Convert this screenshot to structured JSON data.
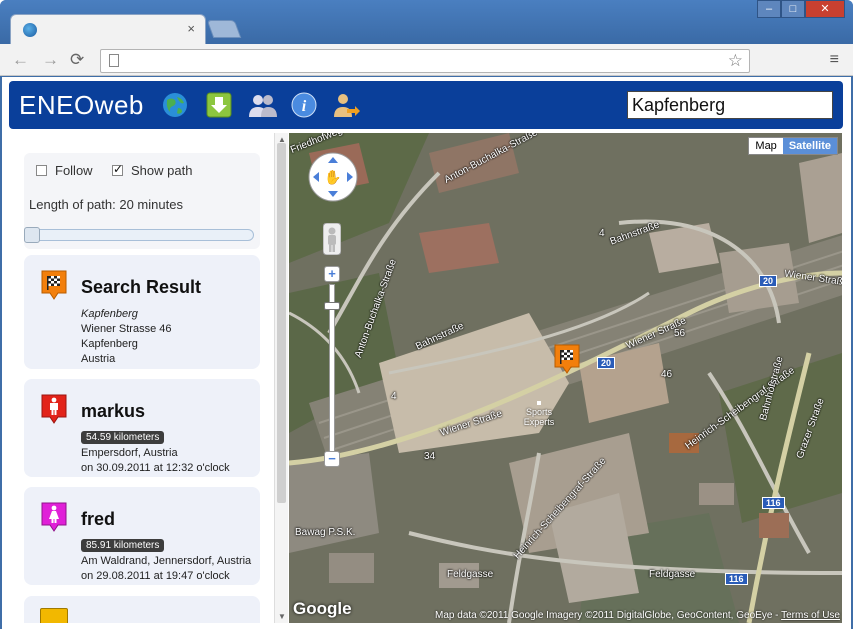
{
  "browser": {
    "tab_close": "×",
    "window_buttons": [
      "‒",
      "□",
      "✕"
    ],
    "nav": {
      "back": "←",
      "forward": "→",
      "reload": "⟳"
    },
    "star": "☆",
    "menu": "≡"
  },
  "header": {
    "logo": "ENEOweb",
    "search_value": "Kapfenberg",
    "icons": [
      "globe-icon",
      "download-icon",
      "users-icon",
      "info-icon",
      "user-login-icon"
    ]
  },
  "controls": {
    "follow_label": "Follow",
    "follow_checked": false,
    "show_path_label": "Show path",
    "show_path_checked": true,
    "path_length": "Length of path: 20 minutes"
  },
  "cards": [
    {
      "title": "Search Result",
      "marker": "checkered-flag-icon",
      "marker_color": "#f27f0c",
      "lines": [
        "Kapfenberg",
        "Wiener Strasse 46",
        "Kapfenberg",
        "Austria"
      ]
    },
    {
      "title": "markus",
      "marker": "male-icon",
      "marker_color": "#e2231a",
      "distance": "54.59 kilometers",
      "lines": [
        "Empersdorf, Austria",
        "on 30.09.2011 at 12:32 o'clock"
      ]
    },
    {
      "title": "fred",
      "marker": "female-icon",
      "marker_color": "#e020d8",
      "distance": "85.91 kilometers",
      "lines": [
        "Am Waldrand, Jennersdorf, Austria",
        "on 29.08.2011 at 19:47 o'clock"
      ]
    }
  ],
  "map": {
    "type_buttons": [
      "Map",
      "Satellite"
    ],
    "active_type": "Satellite",
    "zoom_in": "+",
    "zoom_out": "−",
    "logo": "Google",
    "credit": "Map data ©2011 Google Imagery ©2011 DigitalGlobe, GeoContent, GeoEye - ",
    "terms": "Terms of Use",
    "streets": [
      "Friedhofweg",
      "Anton-Buchalka-Straße",
      "Anton-Buchalka-Straße",
      "Bahnstraße",
      "Bahnstraße",
      "Wiener Straße",
      "Wiener Straße",
      "Wiener Straße",
      "Heinrich-Scheibengraf-Straße",
      "Heinrich-Scheibengraf-Straße",
      "Grazer Straße",
      "Feldgasse",
      "Feldgasse",
      "Bahnhofstraße",
      "Bawag P.S.K."
    ],
    "shields": [
      "20",
      "20",
      "116",
      "116"
    ],
    "numbers": [
      "4",
      "4",
      "34",
      "56",
      "46"
    ],
    "poi": "Sports Experts"
  }
}
